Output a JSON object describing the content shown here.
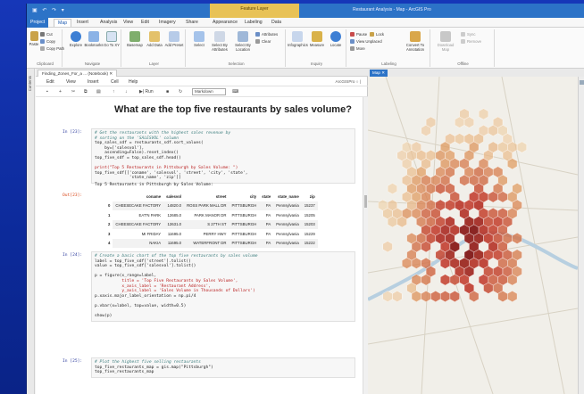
{
  "window": {
    "title": "Restaurant Analysis - Map - ArcGIS Pro",
    "quick_access": "▣ ↶ ↷ ▾",
    "contextual_group": "Feature Layer"
  },
  "ribbon_tabs": [
    "Project",
    "Map",
    "Insert",
    "Analysis",
    "View",
    "Edit",
    "Imagery",
    "Share",
    "Appearance",
    "Labeling",
    "Data"
  ],
  "ribbon": {
    "clipboard": {
      "label": "Clipboard",
      "paste": "Paste",
      "cut": "Cut",
      "copy": "Copy",
      "copy_path": "Copy Path"
    },
    "navigate": {
      "label": "Navigate",
      "explore": "Explore",
      "bookmarks": "Bookmarks",
      "go_to_xy": "Go To XY"
    },
    "layer": {
      "label": "Layer",
      "basemap": "Basemap",
      "add_data": "Add Data",
      "add_preset": "Add Preset"
    },
    "selection": {
      "label": "Selection",
      "select": "Select",
      "by_attributes": "Select By Attributes",
      "by_location": "Select By Location",
      "attributes": "Attributes",
      "clear": "Clear"
    },
    "inquiry": {
      "label": "Inquiry",
      "infographics": "Infographics",
      "measure": "Measure",
      "locate": "Locate"
    },
    "labeling": {
      "label": "Labeling",
      "pause": "Pause",
      "lock": "Lock",
      "view_unplaced": "View Unplaced",
      "more": "More",
      "convert": "Convert To Annotation"
    },
    "offline": {
      "label": "Offline",
      "download_map": "Download Map",
      "sync": "Sync",
      "remove": "Remove"
    }
  },
  "catalog_strip": "Contents",
  "notebook": {
    "tab": "Finding_Zones_For_a ... (Notebook) ✕",
    "menu": [
      "Edit",
      "View",
      "Insert",
      "Cell",
      "Help"
    ],
    "kernel": "ArcGISPro ○ |",
    "toolbar": {
      "save": "▪",
      "add": "+",
      "cut": "✂",
      "copy": "⧉",
      "paste": "▤",
      "up": "↑",
      "down": "↓",
      "run": "▶| Run",
      "stop": "■",
      "restart": "↻",
      "cell_type": "Markdown",
      "keyboard": "⌨"
    },
    "heading": "What are the top five restaurants by sales volume?",
    "cells": [
      {
        "prompt": "In [23]:",
        "lines": [
          {
            "t": "# Get the restaurants with the highest sales revenue by",
            "k": "c"
          },
          {
            "t": "# sorting on the 'SALESVOL' column",
            "k": "c"
          },
          {
            "t": "top_sales_sdf = restaurants_sdf.sort_values(",
            "k": ""
          },
          {
            "t": "    by=['salesvol'],",
            "k": ""
          },
          {
            "t": "    ascending=False).reset_index()",
            "k": ""
          },
          {
            "t": "top_five_sdf = top_sales_sdf.head()",
            "k": ""
          },
          {
            "t": "",
            "k": ""
          },
          {
            "t": "print(\"Top 5 Restaurants in Pittsburgh by Sales Volume: \")",
            "k": "s"
          },
          {
            "t": "top_five_sdf[['coname', 'salesvol', 'street', 'city', 'state',",
            "k": ""
          },
          {
            "t": "              'state_name', 'zip']]",
            "k": ""
          }
        ]
      },
      {
        "prompt": "In [24]:",
        "lines": [
          {
            "t": "# Create a basic chart of the top five restaurants by sales volume",
            "k": "c"
          },
          {
            "t": "label = top_five_sdf['street'].tolist()",
            "k": ""
          },
          {
            "t": "value = top_five_sdf['salesvol'].tolist()",
            "k": ""
          },
          {
            "t": "",
            "k": ""
          },
          {
            "t": "p = figure(x_range=label,",
            "k": ""
          },
          {
            "t": "           title = 'Top Five Restaurants by Sales Volume',",
            "k": "s"
          },
          {
            "t": "           x_axis_label = 'Restaurant Address',",
            "k": "s"
          },
          {
            "t": "           y_axis_label = 'Sales Volume in Thousands of Dollars')",
            "k": "s"
          },
          {
            "t": "p.xaxis.major_label_orientation = np.pi/4",
            "k": ""
          },
          {
            "t": "",
            "k": ""
          },
          {
            "t": "p.vbar(x=label, top=value, width=0.5)",
            "k": ""
          },
          {
            "t": "",
            "k": ""
          },
          {
            "t": "show(p)",
            "k": ""
          }
        ]
      },
      {
        "prompt": "In [25]:",
        "lines": [
          {
            "t": "# Plot the highest five selling restaurants",
            "k": "c"
          },
          {
            "t": "top_five_restaurants_map = gis.map(\"Pittsburgh\")",
            "k": ""
          },
          {
            "t": "top_five_restaurants_map",
            "k": ""
          }
        ]
      }
    ],
    "stdout": "Top 5 Restaurants in Pittsburgh by Sales Volume:",
    "out_prompt": "Out[23]:",
    "table": {
      "columns": [
        "",
        "coname",
        "salesvol",
        "street",
        "city",
        "state",
        "state_name",
        "zip"
      ],
      "rows": [
        [
          "0",
          "CHEESECAKE FACTORY",
          "14820.0",
          "ROSS PARK MALL DR",
          "PITTSBURGH",
          "PA",
          "Pennsylvania",
          "15237"
        ],
        [
          "1",
          "EAT'N PARK",
          "12685.0",
          "PARK MANOR DR",
          "PITTSBURGH",
          "PA",
          "Pennsylvania",
          "15205"
        ],
        [
          "2",
          "CHEESECAKE FACTORY",
          "12631.0",
          "S 27TH ST",
          "PITTSBURGH",
          "PA",
          "Pennsylvania",
          "15203"
        ],
        [
          "3",
          "MI FRIDAY",
          "11695.0",
          "PERRY HWY",
          "PITTSBURGH",
          "PA",
          "Pennsylvania",
          "15229"
        ],
        [
          "4",
          "NAKIA",
          "11695.0",
          "WATERFRONT DR",
          "PITTSBURGH",
          "PA",
          "Pennsylvania",
          "15222"
        ]
      ]
    }
  },
  "map": {
    "tab": "Map ✕",
    "colors": {
      "low": "#f2d9b3",
      "mid": "#e09a5c",
      "high": "#c0392b",
      "peak": "#7f1d1d"
    }
  }
}
